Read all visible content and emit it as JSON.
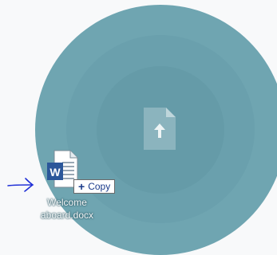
{
  "drop_zone": {
    "upload_icon": "upload-file-icon"
  },
  "dragged_file": {
    "icon": "word-document-icon",
    "icon_letter": "W",
    "name": "Welcome aboard.docx"
  },
  "drag_tooltip": {
    "icon": "plus-icon",
    "plus_glyph": "+",
    "label": "Copy"
  },
  "annotation": {
    "icon": "hand-drawn-arrow-icon"
  },
  "colors": {
    "background": "#f8f9fa",
    "drop_zone": "#6fa5b1",
    "word_blue": "#2b579a",
    "tooltip_text": "#1a3a8a",
    "annotation_blue": "#1f2fd6"
  }
}
